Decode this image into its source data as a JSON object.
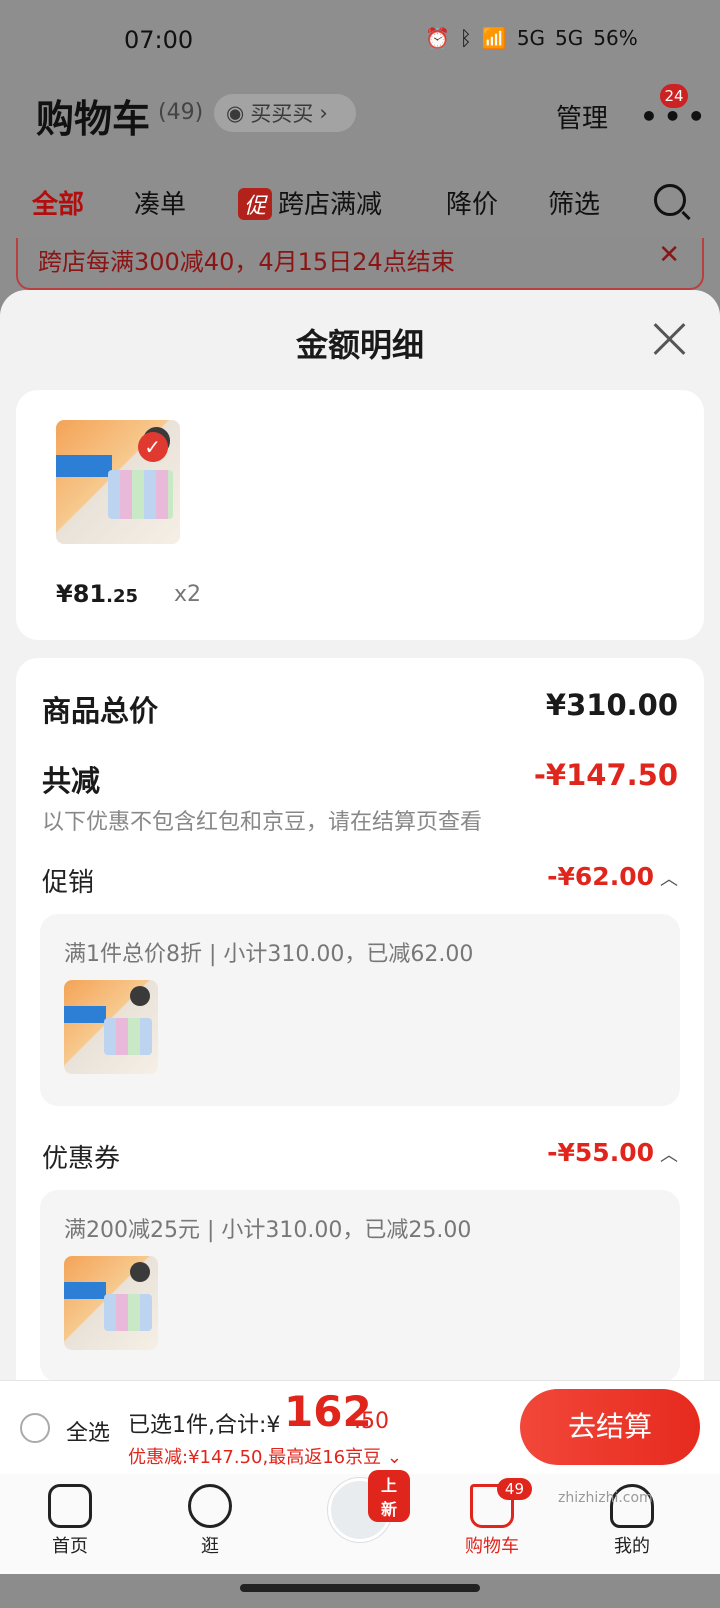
{
  "status_bar": {
    "time": "07:00",
    "battery": "56%",
    "network1": "5G",
    "network2": "5G"
  },
  "header": {
    "title": "购物车",
    "count": "(49)",
    "maimai": "买买买",
    "manage": "管理",
    "more_badge": "24"
  },
  "tabs": [
    {
      "label": "全部"
    },
    {
      "label": "凑单"
    },
    {
      "tag": "促",
      "label": "跨店满减"
    },
    {
      "label": "降价"
    },
    {
      "label": "筛选"
    }
  ],
  "banner": {
    "text": "跨店每满300减40，4月15日24点结束"
  },
  "sheet": {
    "title": "金额明细",
    "item": {
      "price_main": "¥81",
      "price_decimal": ".25",
      "qty": "x2"
    },
    "total_label": "商品总价",
    "total_value": "¥310.00",
    "reduce_label": "共减",
    "reduce_value": "-¥147.50",
    "note": "以下优惠不包含红包和京豆，请在结算页查看",
    "promo": {
      "label": "促销",
      "value": "-¥62.00",
      "desc": "满1件总价8折 | 小计310.00，已减62.00"
    },
    "coupon": {
      "label": "优惠券",
      "value": "-¥55.00",
      "desc": "满200减25元 | 小计310.00，已减25.00"
    }
  },
  "checkout": {
    "select_all": "全选",
    "summary": "已选1件,合计:¥",
    "total_big": "162",
    "total_small": ".50",
    "discount": "优惠减:¥147.50,最高返16京豆",
    "button": "去结算"
  },
  "nav": {
    "home": "首页",
    "browse": "逛",
    "new_tag": "上新",
    "cart": "购物车",
    "cart_badge": "49",
    "me": "我的"
  },
  "watermark": "zhizhizhi.com"
}
